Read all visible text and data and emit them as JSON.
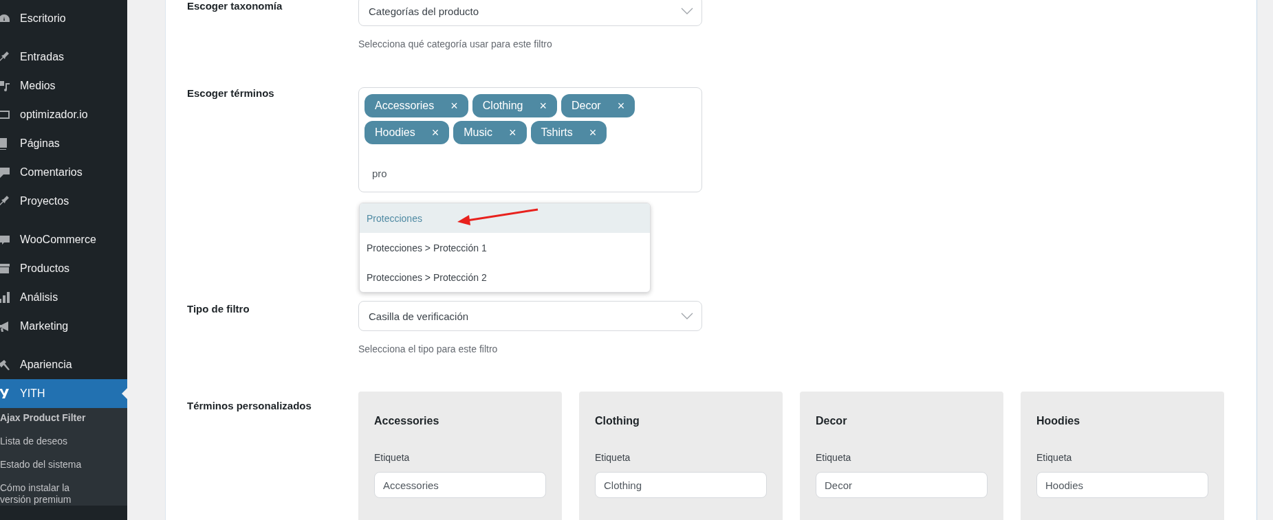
{
  "sidebar": {
    "groups": [
      {
        "items": [
          {
            "label": "Escritorio",
            "selected": false
          }
        ]
      },
      {
        "items": [
          {
            "label": "Entradas",
            "selected": false
          },
          {
            "label": "Medios",
            "selected": false
          },
          {
            "label": "optimizador.io",
            "selected": false
          },
          {
            "label": "Páginas",
            "selected": false
          },
          {
            "label": "Comentarios",
            "selected": false
          },
          {
            "label": "Proyectos",
            "selected": false
          }
        ]
      },
      {
        "items": [
          {
            "label": "WooCommerce",
            "selected": false
          },
          {
            "label": "Productos",
            "selected": false
          },
          {
            "label": "Análisis",
            "selected": false
          },
          {
            "label": "Marketing",
            "selected": false
          }
        ]
      },
      {
        "items": [
          {
            "label": "Apariencia",
            "selected": false
          },
          {
            "label": "YITH",
            "selected": true
          }
        ]
      }
    ],
    "submenu": [
      {
        "label": "Ajax Product Filter",
        "selected": true
      },
      {
        "label": "Lista de deseos",
        "selected": false
      },
      {
        "label": "Estado del sistema",
        "selected": false
      },
      {
        "label": "Cómo instalar la versión premium",
        "selected": false
      }
    ]
  },
  "form": {
    "taxonomy": {
      "label": "Escoger taxonomía",
      "value": "Categorías del producto",
      "hint": "Selecciona qué categoría usar para este filtro"
    },
    "terms": {
      "label": "Escoger términos",
      "tags": [
        "Accessories",
        "Clothing",
        "Decor",
        "Hoodies",
        "Music",
        "Tshirts"
      ],
      "remove_symbol": "×",
      "query": "pro",
      "suggestions": [
        {
          "label": "Protecciones",
          "selected": true
        },
        {
          "label": "Protecciones > Protección 1",
          "selected": false
        },
        {
          "label": "Protecciones > Protección 2",
          "selected": false
        }
      ]
    },
    "filter_type": {
      "label": "Tipo de filtro",
      "value": "Casilla de verificación",
      "hint": "Selecciona el tipo para este filtro"
    },
    "custom_terms": {
      "label": "Términos personalizados",
      "cards": [
        {
          "title": "Accessories",
          "field_label": "Etiqueta",
          "value": "Accessories"
        },
        {
          "title": "Clothing",
          "field_label": "Etiqueta",
          "value": "Clothing"
        },
        {
          "title": "Decor",
          "field_label": "Etiqueta",
          "value": "Decor"
        },
        {
          "title": "Hoodies",
          "field_label": "Etiqueta",
          "value": "Hoodies"
        }
      ]
    }
  }
}
